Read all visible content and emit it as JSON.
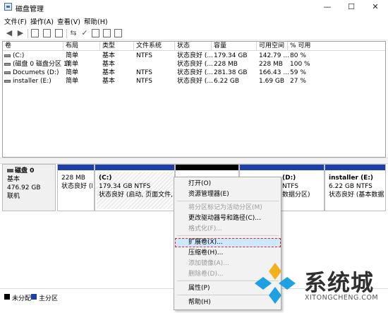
{
  "window": {
    "title": "磁盘管理",
    "minimize": "—",
    "maximize": "☐",
    "close": "✕"
  },
  "menu": [
    "文件(F)",
    "操作(A)",
    "查看(V)",
    "帮助(H)"
  ],
  "toolbar_icons": [
    "back-icon",
    "forward-icon",
    "properties-pane-icon",
    "help-icon",
    "console-tree-icon",
    "connect-icon",
    "check-icon",
    "folder-icon",
    "new-doc-icon",
    "window-icon"
  ],
  "table": {
    "columns": [
      "卷",
      "布局",
      "类型",
      "文件系统",
      "状态",
      "容量",
      "可用空间",
      "% 可用"
    ],
    "rows": [
      [
        "(C:)",
        "简单",
        "基本",
        "NTFS",
        "状态良好 (...",
        "179.34 GB",
        "142.79 ...",
        "80 %"
      ],
      [
        "(磁盘 0 磁盘分区 1)",
        "简单",
        "基本",
        "",
        "状态良好 (...",
        "228 MB",
        "228 MB",
        "100 %"
      ],
      [
        "Documets (D:)",
        "简单",
        "基本",
        "NTFS",
        "状态良好 (...",
        "281.38 GB",
        "166.43 ...",
        "59 %"
      ],
      [
        "installer (E:)",
        "简单",
        "基本",
        "NTFS",
        "状态良好 (...",
        "6.22 GB",
        "1.69 GB",
        "27 %"
      ]
    ]
  },
  "disk": {
    "name": "磁盘 0",
    "type": "基本",
    "size": "476.92 GB",
    "status": "联机"
  },
  "partitions": [
    {
      "name": "",
      "line1": "228 MB",
      "line2": "状态良好 (E"
    },
    {
      "name": "(C:)",
      "line1": "179.34 GB NTFS",
      "line2": "状态良好 (启动, 页面文件, 故障"
    },
    {
      "name": "",
      "line1": "",
      "line2": ""
    },
    {
      "name": "(D:)",
      "line1": "NTFS",
      "line2": "数据分区)"
    },
    {
      "name": "installer (E:)",
      "line1": "6.22 GB NTFS",
      "line2": "状态良好 (基本数据分"
    }
  ],
  "legend": {
    "unallocated": "未分配",
    "primary": "主分区",
    "unallocated_color": "#000000",
    "primary_color": "#1e3fa8"
  },
  "context_menu": {
    "open": "打开(O)",
    "explorer": "资源管理器(E)",
    "mark_active": "将分区标记为活动分区(M)",
    "change_letter": "更改驱动器号和路径(C)...",
    "format": "格式化(F)...",
    "extend": "扩展卷(X)...",
    "shrink": "压缩卷(H)...",
    "add_mirror": "添加镜像(A)...",
    "delete": "删除卷(D)...",
    "properties": "属性(P)",
    "help": "帮助(H)"
  },
  "watermark": {
    "title": "系统城",
    "url": "XITONGCHENG.COM"
  }
}
